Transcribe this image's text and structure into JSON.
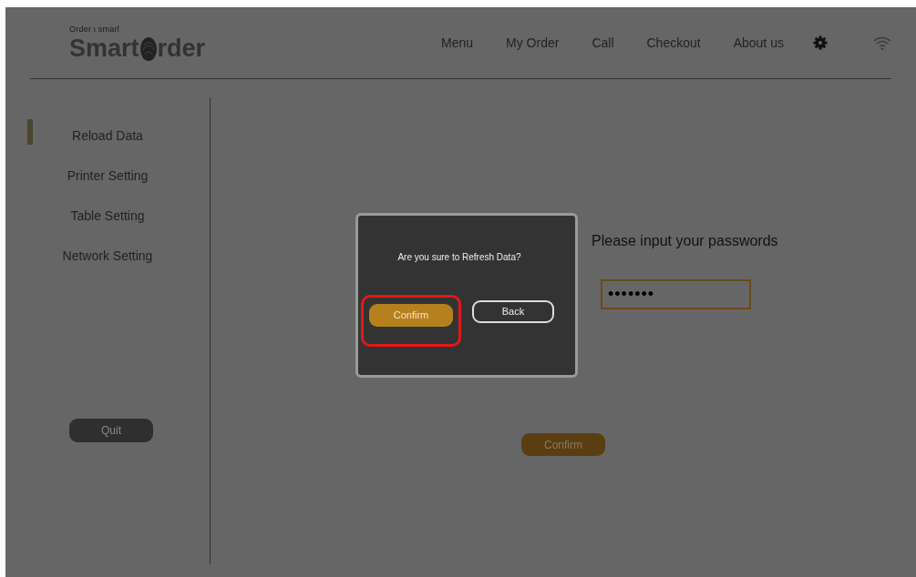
{
  "logo": {
    "tagline": "Order ι smarl",
    "name_start": "Smart ",
    "name_end": "rder"
  },
  "nav": [
    {
      "label": "Menu"
    },
    {
      "label": "My Order"
    },
    {
      "label": "Call"
    },
    {
      "label": "Checkout"
    },
    {
      "label": "About us"
    }
  ],
  "sidebar": {
    "items": [
      {
        "label": "Reload Data",
        "selected": true
      },
      {
        "label": "Printer Setting",
        "selected": false
      },
      {
        "label": "Table Setting",
        "selected": false
      },
      {
        "label": "Network Setting",
        "selected": false
      }
    ],
    "quit": "Quit"
  },
  "main": {
    "heading": "Please input your passwords",
    "password": "•••••••",
    "confirm": "Confirm"
  },
  "dialog": {
    "message": "Are you sure to Refresh Data?",
    "confirm": "Confirm",
    "back": "Back",
    "confirm_highlighted": true
  }
}
